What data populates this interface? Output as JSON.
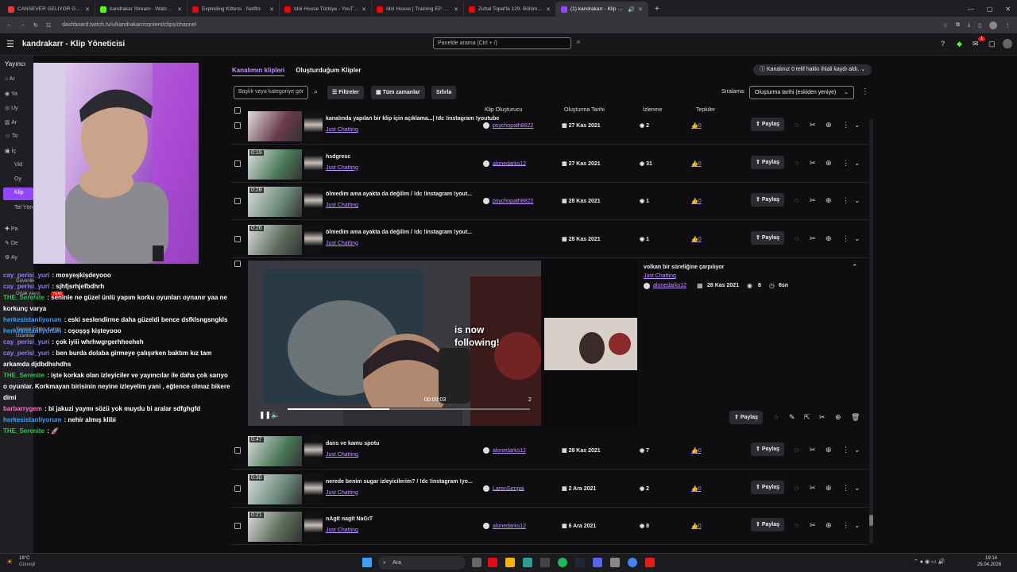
{
  "browser": {
    "tabs": [
      {
        "label": "CANSEVER GELIYOR GELIYOR K",
        "color": "#e53935"
      },
      {
        "label": "kandrakar Stream - Watch Live",
        "color": "#53fc18"
      },
      {
        "label": "Exploding Kittens · Netflix",
        "color": "#e50914"
      },
      {
        "label": "Idol House Türkiye - YouTube",
        "color": "#ff0000"
      },
      {
        "label": "Idol House | Training EP 11 | Ar",
        "color": "#ff0000"
      },
      {
        "label": "Zuhal Topal'la 129. Bölüm (HD)",
        "color": "#ff0000"
      },
      {
        "label": "(1) kandrakarr - Klip Yönetic",
        "color": "#9146ff"
      }
    ],
    "url": "dashboard.twitch.tv/u/kandrakarr/content/clips/channel"
  },
  "topnav": {
    "title": "kandrakarr - Klip Yöneticisi",
    "search_placeholder": "Panelde arama (Ctrl + /)",
    "notif_count": "1"
  },
  "sidebar": {
    "header": "Yayıncı",
    "items": [
      "Ar",
      "Ya",
      "Uy",
      "Ar",
      "To",
      "İç",
      "Vid",
      "Oy",
      "Klip",
      "Tel Yön",
      "Pa",
      "De",
      "Ay"
    ],
    "tail": [
      "Güvenlik",
      "Ortak yayın",
      "Uzantılar",
      "Yayıncı Eğitim Kampı"
    ],
    "new_badge": "YENİ"
  },
  "chat": [
    {
      "user": "cay_perisi_yuri",
      "color": "#8a7cff",
      "msg": "mosyeşkişdeyooo"
    },
    {
      "user": "cay_perisi_yuri",
      "color": "#8a7cff",
      "msg": "sjhfjsrhjefbdhrh"
    },
    {
      "user": "THE_Serenite",
      "color": "#2ec44d",
      "msg": "seninle ne güzel ünlü yapım korku oyunları oynanır yaa ne korkunç varya"
    },
    {
      "user": "herkesistanliyorum",
      "color": "#3aa0ff",
      "msg": "eski seslendirme daha güzeldi bence dsfklsngsngkls"
    },
    {
      "user": "herkesistanliyorum",
      "color": "#3aa0ff",
      "msg": "oşoşşş kişteyooo"
    },
    {
      "user": "cay_perisi_yuri",
      "color": "#8a7cff",
      "msg": "çok iyiii whrhwgrgerhheeheh"
    },
    {
      "user": "cay_perisi_yuri",
      "color": "#8a7cff",
      "msg": "ben burda dolaba girmeye çalışırken baktım kız tam arkamda djdbdhshdhs"
    },
    {
      "user": "THE_Serenite",
      "color": "#2ec44d",
      "msg": "işte korkak olan izleyiciler ve yayıncılar ile daha çok sarıyo o oyunlar. Korkmayan birisinin neyine izleyelim yani , eğlence olmaz bikere dimi"
    },
    {
      "user": "barbarrygem",
      "color": "#ff6ec7",
      "msg": "bi jakuzi yaymı sözü yok muydu bi aralar sdfghgfd"
    },
    {
      "user": "herkesistanliyorum",
      "color": "#3aa0ff",
      "msg": "nehir almış klibi"
    },
    {
      "user": "THE_Serenite",
      "color": "#2ec44d",
      "msg": "🚀"
    }
  ],
  "main": {
    "tab_channel": "Kanalımın klipleri",
    "tab_created": "Oluşturduğum Klipler",
    "notice": "Kanalınız 0 telif hakkı ihlali kaydı aldı.",
    "title_search_placeholder": "Başlık veya kategoriye gör",
    "filters": "Filtreler",
    "all_time": "Tüm zamanlar",
    "reset": "Sıfırla",
    "sort_label": "Sıralama:",
    "sort_value": "Oluşturma tarihi (eskiden yeniye)",
    "columns": {
      "creator": "Klip Oluşturucu",
      "date": "Oluşturma Tarihi",
      "views": "İzlenme",
      "reactions": "Tepkiler"
    },
    "share": "Paylaş"
  },
  "clips": [
    {
      "dur": "",
      "title": "kanalında yapılan bir klip için açıklama...| !dc !instagram !youtube",
      "category": "Just Chatting",
      "creator": "psychopath8822",
      "date": "27 Kas 2021",
      "views": "2",
      "reactions": "0"
    },
    {
      "dur": "0:19",
      "title": "hsdgresc",
      "category": "Just Chatting",
      "creator": "alonedarks12",
      "date": "27 Kas 2021",
      "views": "31",
      "reactions": "0"
    },
    {
      "dur": "0:28",
      "title": "ölmedim ama ayakta da değilim / !dc !instagram !yout...",
      "category": "Just Chatting",
      "creator": "psychopath8822",
      "date": "28 Kas 2021",
      "views": "1",
      "reactions": "0"
    },
    {
      "dur": "0:26",
      "title": "ölmedim ama ayakta da değilim / !dc !instagram !yout...",
      "category": "Just Chatting",
      "creator": "",
      "date": "28 Kas 2021",
      "views": "1",
      "reactions": "0"
    }
  ],
  "expanded": {
    "title": "volkan bir süreliğine çarpılıyor",
    "category": "Just Chatting",
    "creator": "alonedarks12",
    "date": "28 Kas 2021",
    "views": "8",
    "duration": "6sn",
    "overlay_text1": "is now",
    "overlay_text2": "following!",
    "time": "00:00:03",
    "count": "2",
    "share": "Paylaş",
    "progress": 0.42
  },
  "clips2": [
    {
      "dur": "0:47",
      "title": "dans ve kamu spotu",
      "category": "Just Chatting",
      "creator": "alonedarks12",
      "date": "28 Kas 2021",
      "views": "7",
      "reactions": "0"
    },
    {
      "dur": "0:30",
      "title": "nerede benim sugar izleyicilerim? / !dc !instagram !yo...",
      "category": "Just Chatting",
      "creator": "LarenSenpai",
      "date": "2 Ara 2021",
      "views": "2",
      "reactions": "0"
    },
    {
      "dur": "0:21",
      "title": "nAgIt nagIt NaGıT",
      "category": "Just Chatting",
      "creator": "alonedarks12",
      "date": "6 Ara 2021",
      "views": "8",
      "reactions": "0"
    }
  ],
  "taskbar": {
    "weather_temp": "18°C",
    "weather_desc": "Güneşli",
    "search": "Ara",
    "time": "19:14",
    "date": "26.04.2026"
  }
}
